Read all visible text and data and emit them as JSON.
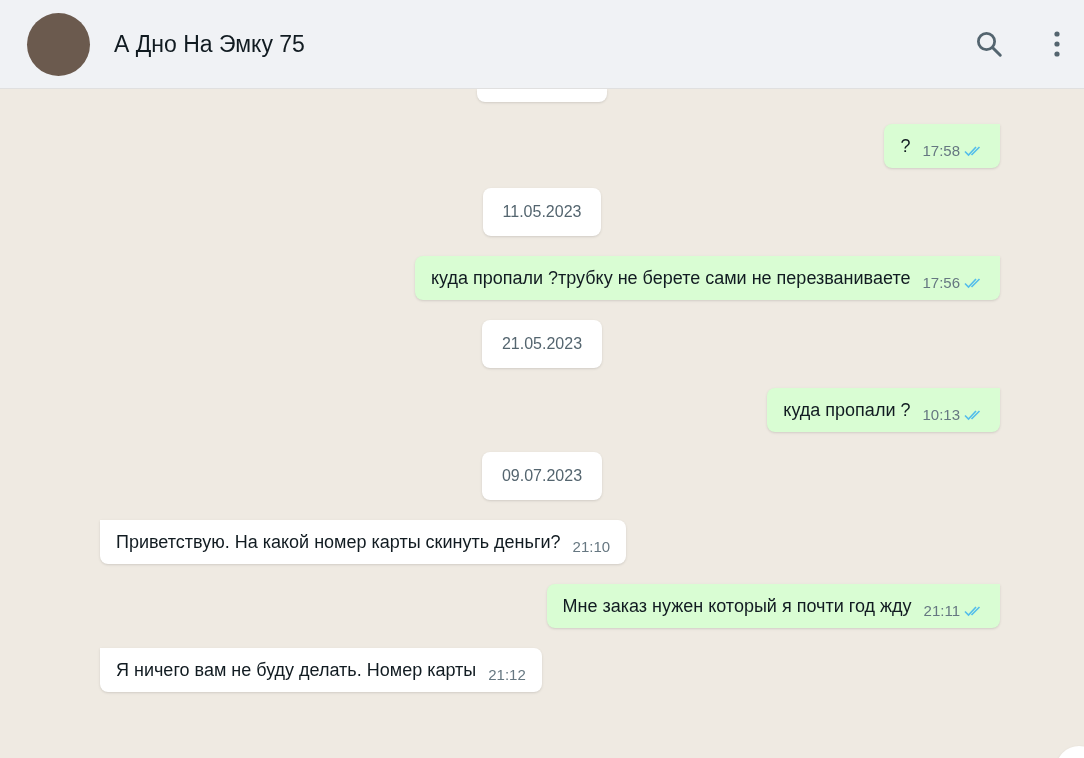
{
  "header": {
    "title": "А Дно На Эмку 75"
  },
  "messages": [
    {
      "kind": "out",
      "text": "?",
      "time": "17:58",
      "read": true
    },
    {
      "kind": "date",
      "text": "11.05.2023"
    },
    {
      "kind": "out",
      "text": "куда пропали ?трубку не берете сами не перезваниваете",
      "time": "17:56",
      "read": true
    },
    {
      "kind": "date",
      "text": "21.05.2023"
    },
    {
      "kind": "out",
      "text": "куда пропали ?",
      "time": "10:13",
      "read": true
    },
    {
      "kind": "date",
      "text": "09.07.2023"
    },
    {
      "kind": "in",
      "text": "Приветствую. На какой номер карты скинуть деньги?",
      "time": "21:10"
    },
    {
      "kind": "out",
      "text": "Мне заказ нужен который я почти год жду",
      "time": "21:11",
      "read": true
    },
    {
      "kind": "in",
      "text": "Я ничего вам не буду делать. Номер карты",
      "time": "21:12"
    }
  ]
}
